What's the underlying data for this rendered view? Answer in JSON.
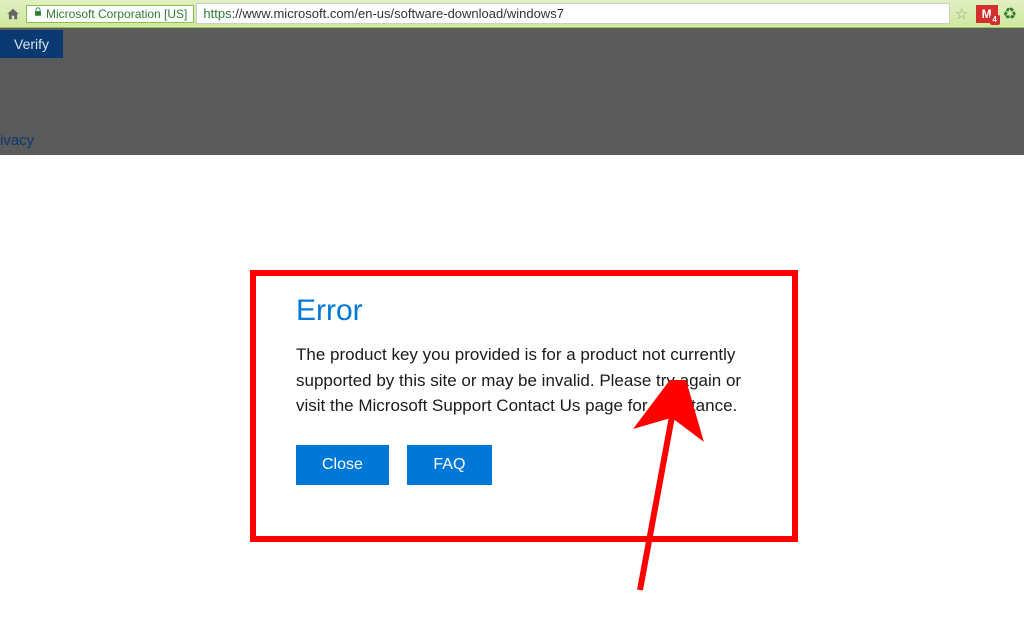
{
  "address": {
    "ssl_label": "Microsoft Corporation [US]",
    "url_https": "https",
    "url_rest": "://www.microsoft.com/en-us/software-download/windows7",
    "gmail_count": "4"
  },
  "overlay": {
    "verify": "Verify",
    "privacy_fragment": "ivacy"
  },
  "error": {
    "title": "Error",
    "message": "The product key you provided is for a product not currently supported by this site or may be invalid. Please try again or visit the Microsoft Support Contact Us page for assistance.",
    "close_btn": "Close",
    "faq_btn": "FAQ"
  }
}
